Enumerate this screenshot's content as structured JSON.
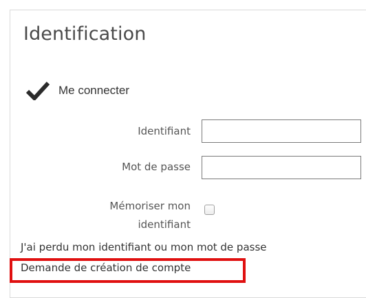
{
  "panel": {
    "title": "Identification"
  },
  "connect": {
    "icon": "checkmark-icon",
    "label": "Me connecter"
  },
  "form": {
    "username_label": "Identifiant",
    "username_value": "",
    "password_label": "Mot de passe",
    "password_value": "",
    "remember_label_line1": "Mémoriser mon",
    "remember_label_line2": "identifiant",
    "remember_checked": false
  },
  "links": {
    "lost_credentials": "J'ai perdu mon identifiant ou mon mot de passe",
    "create_account": "Demande de création de compte"
  },
  "colors": {
    "highlight": "#e01010",
    "panel_border": "#d9d9d9"
  }
}
